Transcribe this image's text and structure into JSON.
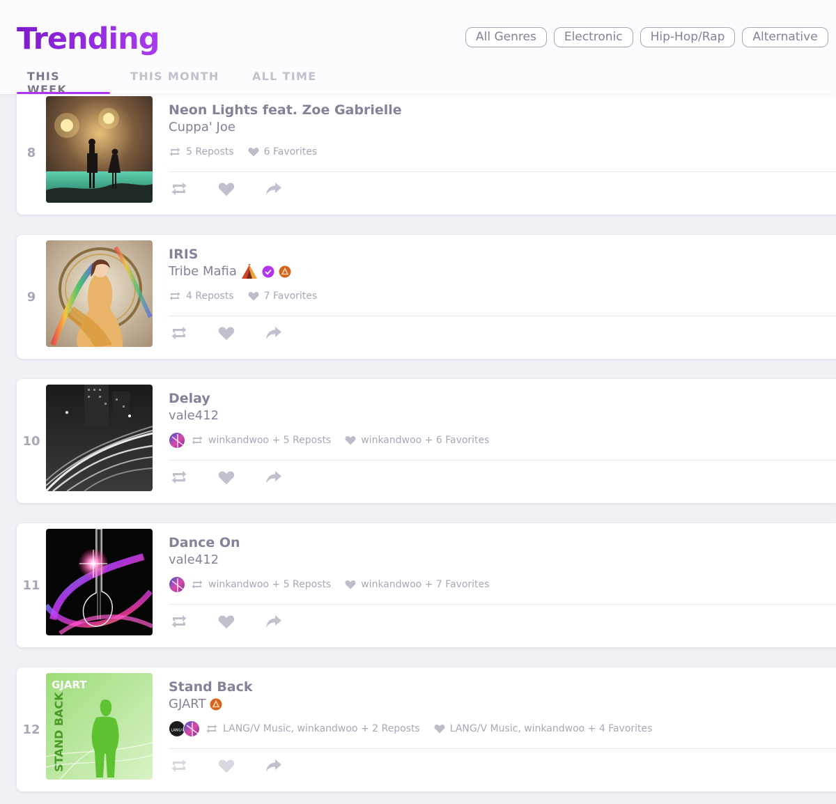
{
  "header": {
    "title": "Trending",
    "genres": [
      "All Genres",
      "Electronic",
      "Hip-Hop/Rap",
      "Alternative"
    ],
    "tabs": [
      "THIS WEEK",
      "THIS MONTH",
      "ALL TIME"
    ],
    "active_tab": "THIS WEEK"
  },
  "tracks": [
    {
      "rank": "8",
      "title": "Neon Lights feat. Zoe Gabrielle",
      "artist": "Cuppa' Joe",
      "reposts": "5 Reposts",
      "favorites": "6 Favorites"
    },
    {
      "rank": "9",
      "title": "IRIS",
      "artist": "Tribe Mafia",
      "artist_badges": [
        "tent-emoji",
        "verified-badge-icon",
        "tier-badge-icon"
      ],
      "reposts": "4 Reposts",
      "favorites": "7 Favorites"
    },
    {
      "rank": "10",
      "title": "Delay",
      "artist": "vale412",
      "reposts": "winkandwoo + 5 Reposts",
      "favorites": "winkandwoo + 6 Favorites"
    },
    {
      "rank": "11",
      "title": "Dance On",
      "artist": "vale412",
      "reposts": "winkandwoo + 5 Reposts",
      "favorites": "winkandwoo + 7 Favorites"
    },
    {
      "rank": "12",
      "title": "Stand Back",
      "artist": "GJART",
      "artist_badges": [
        "tier-badge-icon"
      ],
      "reposts": "LANG/V Music, winkandwoo + 2 Reposts",
      "favorites": "LANG/V Music, winkandwoo + 4 Favorites",
      "art_text": [
        "GJART",
        "STAND BACK"
      ],
      "avatar_text": "LANG/V"
    }
  ],
  "colors": {
    "accent": "#b132f0",
    "text": "#858199",
    "muted": "#a9a6b8",
    "background": "#f2f0f7"
  },
  "icons": {
    "repost": "repost-icon",
    "favorite": "heart-icon",
    "share": "share-icon"
  }
}
